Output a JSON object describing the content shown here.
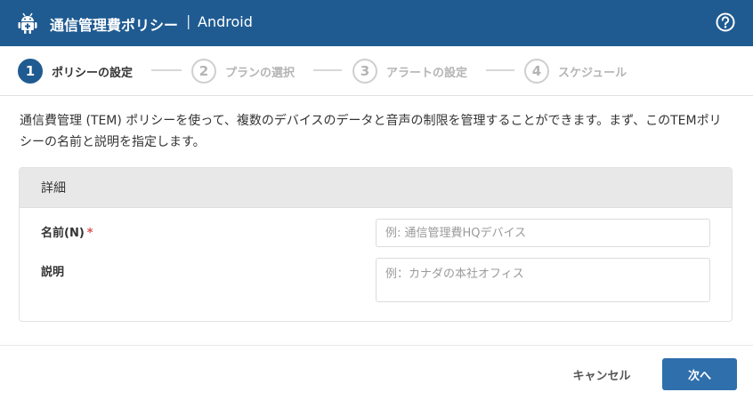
{
  "header": {
    "title": "通信管理費ポリシー",
    "separator": "|",
    "platform": "Android",
    "icon": "android-icon",
    "help_icon": "help-icon",
    "background": "#1f5b91"
  },
  "steps": [
    {
      "number": "1",
      "label": "ポリシーの設定",
      "active": true
    },
    {
      "number": "2",
      "label": "プランの選択",
      "active": false
    },
    {
      "number": "3",
      "label": "アラートの設定",
      "active": false
    },
    {
      "number": "4",
      "label": "スケジュール",
      "active": false
    }
  ],
  "description": "通信費管理 (TEM) ポリシーを使って、複数のデバイスのデータと音声の制限を管理することができます。まず、このTEMポリシーの名前と説明を指定します。",
  "details": {
    "heading": "詳細",
    "name_label": "名前(N)",
    "required_mark": "*",
    "name_placeholder": "例: 通信管理費HQデバイス",
    "name_value": "",
    "desc_label": "説明",
    "desc_placeholder": "例：カナダの本社オフィス",
    "desc_value": ""
  },
  "footer": {
    "cancel_label": "キャンセル",
    "next_label": "次へ",
    "accent": "#2e6fac"
  }
}
